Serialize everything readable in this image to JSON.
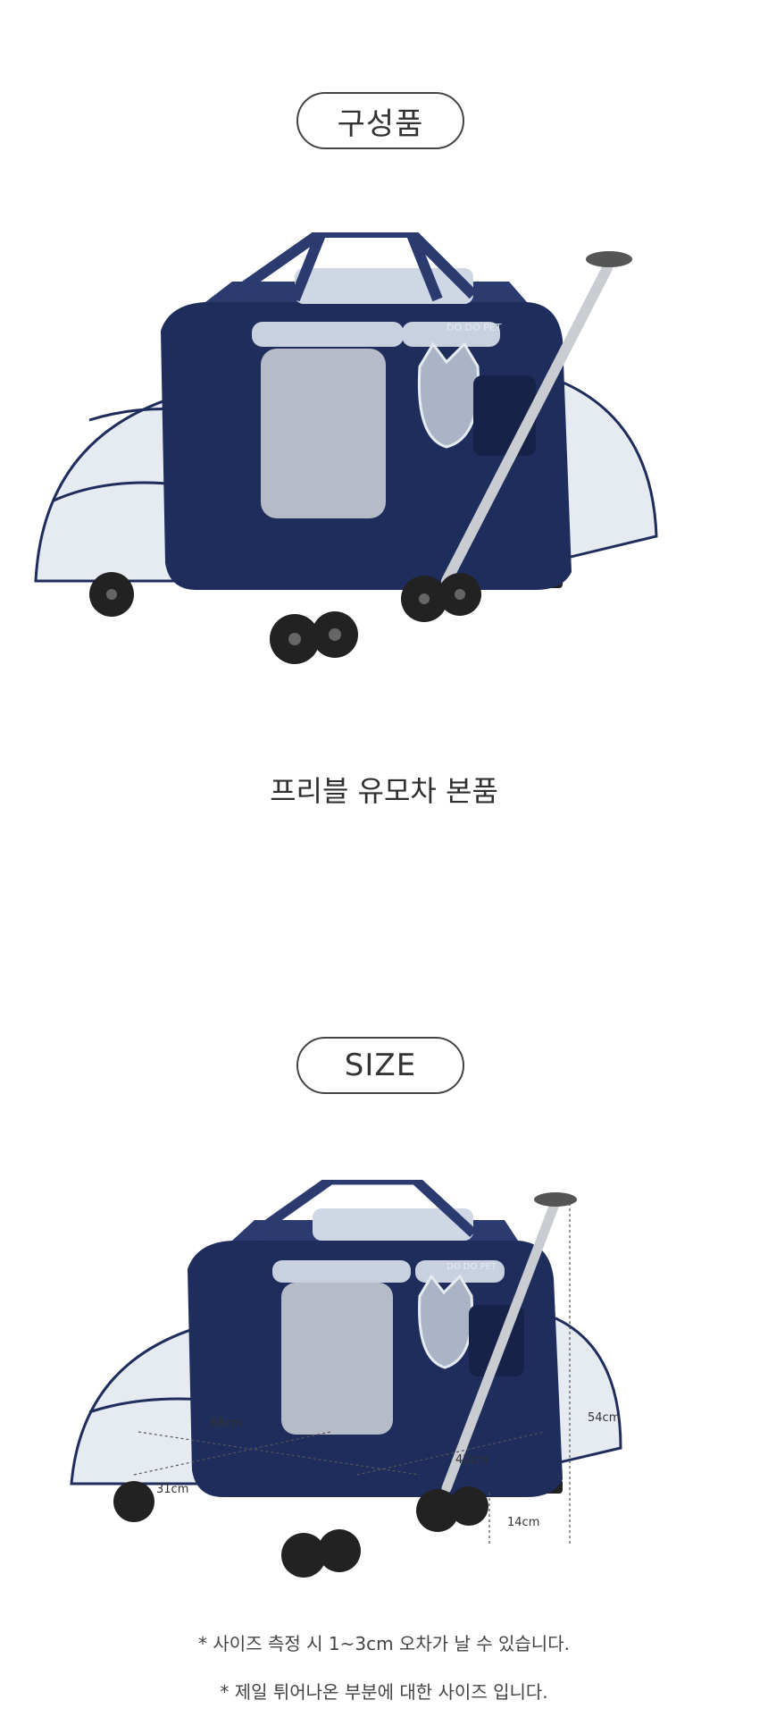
{
  "sections": [
    {
      "badge": "구성품",
      "caption": "프리블 유모차 본품",
      "product_logo": "DO DO PET"
    },
    {
      "badge": "SIZE",
      "product_logo": "DO DO PET",
      "dimensions": {
        "length": "68cm",
        "width": "42cm",
        "depth": "31cm",
        "handle_height": "54cm",
        "wheel_height": "14cm"
      },
      "notes": [
        "* 사이즈 측정 시 1~3cm 오차가 날 수 있습니다.",
        "* 제일 튀어나온 부분에 대한 사이즈 입니다."
      ]
    }
  ],
  "colors": {
    "navy": "#1f2d5c",
    "navy_dark": "#162247",
    "mesh": "#e6ebf2",
    "handle": "#c9cdd2",
    "wheel": "#222222"
  }
}
